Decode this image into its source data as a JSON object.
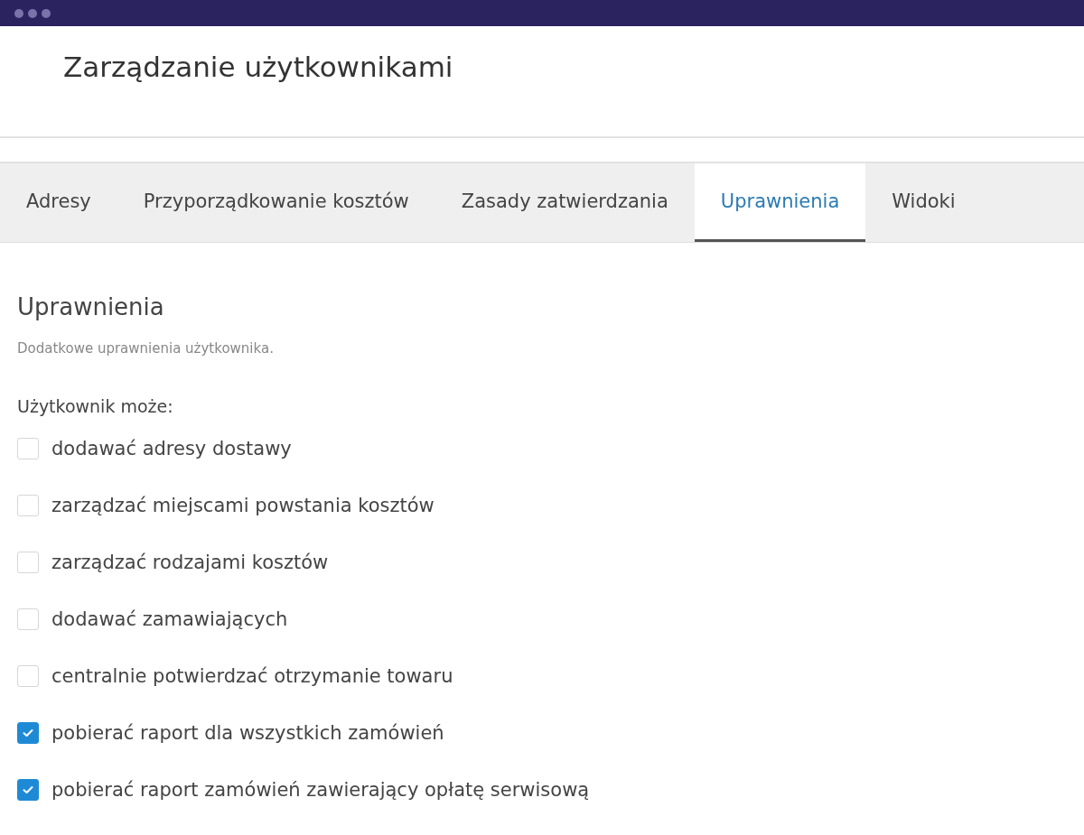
{
  "page": {
    "title": "Zarządzanie użytkownikami"
  },
  "tabs": [
    {
      "label": "Adresy",
      "selected": false
    },
    {
      "label": "Przyporządkowanie kosztów",
      "selected": false
    },
    {
      "label": "Zasady zatwierdzania",
      "selected": false
    },
    {
      "label": "Uprawnienia",
      "selected": true
    },
    {
      "label": "Widoki",
      "selected": false
    }
  ],
  "section": {
    "heading": "Uprawnienia",
    "description": "Dodatkowe uprawnienia użytkownika.",
    "prompt": "Użytkownik może:"
  },
  "permissions": [
    {
      "label": "dodawać adresy dostawy",
      "checked": false
    },
    {
      "label": "zarządzać miejscami powstania kosztów",
      "checked": false
    },
    {
      "label": "zarządzać rodzajami kosztów",
      "checked": false
    },
    {
      "label": "dodawać zamawiających",
      "checked": false
    },
    {
      "label": "centralnie potwierdzać otrzymanie towaru",
      "checked": false
    },
    {
      "label": "pobierać raport dla wszystkich zamówień",
      "checked": true
    },
    {
      "label": "pobierać raport zamówień zawierający opłatę serwisową",
      "checked": true
    }
  ]
}
